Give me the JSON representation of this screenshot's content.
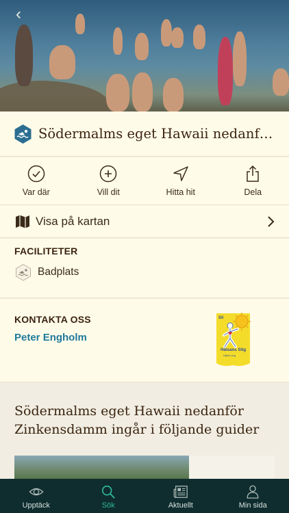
{
  "place": {
    "title": "Södermalms eget Hawaii nedanför Zin…",
    "category_icon": "swim-icon"
  },
  "actions": [
    {
      "label": "Var där",
      "icon": "check-circle-icon"
    },
    {
      "label": "Vill dit",
      "icon": "plus-circle-icon"
    },
    {
      "label": "Hitta hit",
      "icon": "navigation-arrow-icon"
    },
    {
      "label": "Dela",
      "icon": "share-icon"
    }
  ],
  "map": {
    "label": "Visa på kartan",
    "icon": "map-icon"
  },
  "facilities": {
    "heading": "FACILITETER",
    "items": [
      {
        "label": "Badplats",
        "icon": "swim-icon"
      }
    ]
  },
  "contact": {
    "heading": "KONTAKTA OSS",
    "name": "Peter Engholm",
    "logo": {
      "top": "Sii",
      "line1": "Hälsans Stig",
      "line2": "Hjärt-Lung"
    }
  },
  "guides": {
    "title": "Södermalms eget Hawaii nedanför Zinkensdamm ingår i följande guider"
  },
  "tabs": [
    {
      "label": "Upptäck",
      "icon": "eye-icon",
      "active": false
    },
    {
      "label": "Sök",
      "icon": "search-icon",
      "active": true
    },
    {
      "label": "Aktuellt",
      "icon": "newspaper-icon",
      "active": false
    },
    {
      "label": "Min sida",
      "icon": "user-icon",
      "active": false
    }
  ],
  "colors": {
    "background": "#f1ede2",
    "card": "#fffbe9",
    "accent": "#2fb89a",
    "link": "#1f7a9c",
    "tabbar": "#0f2d2f",
    "badge": "#2c6e91"
  }
}
